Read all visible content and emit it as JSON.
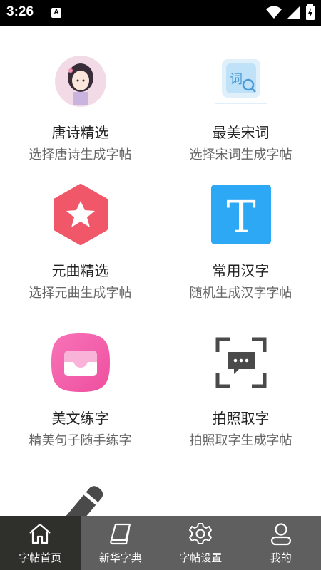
{
  "status_bar": {
    "time": "3:26",
    "badge": "A"
  },
  "cards": [
    {
      "title": "唐诗精选",
      "subtitle": "选择唐诗生成字帖",
      "icon": "avatar-girl-icon"
    },
    {
      "title": "最美宋词",
      "subtitle": "选择宋词生成字帖",
      "icon": "ci-search-icon",
      "icon_text": "词"
    },
    {
      "title": "元曲精选",
      "subtitle": "选择元曲生成字帖",
      "icon": "star-hexagon-icon"
    },
    {
      "title": "常用汉字",
      "subtitle": "随机生成汉字字帖",
      "icon": "letter-t-icon",
      "icon_text": "T"
    },
    {
      "title": "美文练字",
      "subtitle": "精美句子随手练字",
      "icon": "tray-icon"
    },
    {
      "title": "拍照取字",
      "subtitle": "拍照取字生成字帖",
      "icon": "scan-frame-icon"
    },
    {
      "title": "",
      "subtitle": "",
      "icon": "pen-icon"
    }
  ],
  "tabs": [
    {
      "label": "字帖首页",
      "icon": "home-icon",
      "active": true
    },
    {
      "label": "新华字典",
      "icon": "book-icon",
      "active": false
    },
    {
      "label": "字帖设置",
      "icon": "gear-icon",
      "active": false
    },
    {
      "label": "我的",
      "icon": "user-icon",
      "active": false
    }
  ],
  "colors": {
    "tab_bg": "#5f5f5f",
    "tab_active_bg": "#2f2f2b",
    "hexagon": "#f0586a",
    "t_blue": "#2da8f5",
    "tray_pink": "#f25aa5"
  }
}
